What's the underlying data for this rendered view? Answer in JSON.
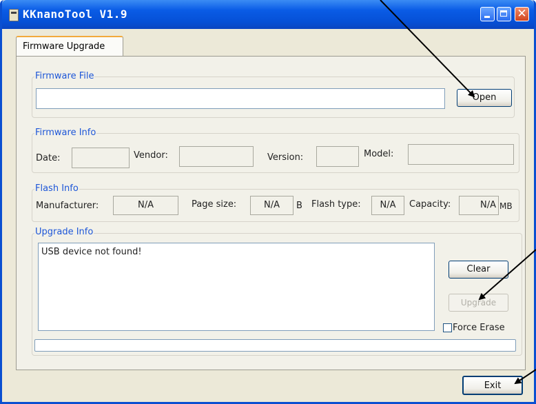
{
  "window": {
    "title": "KKnanoTool V1.9"
  },
  "titlebar_buttons": {
    "close_glyph": "✕"
  },
  "tab": {
    "label": "Firmware Upgrade"
  },
  "firmware_file": {
    "group_label": "Firmware File",
    "path_value": "",
    "open_button": "Open"
  },
  "firmware_info": {
    "group_label": "Firmware Info",
    "date_label": "Date:",
    "date_value": "",
    "vendor_label": "Vendor:",
    "vendor_value": "",
    "version_label": "Version:",
    "version_value": "",
    "model_label": "Model:",
    "model_value": ""
  },
  "flash_info": {
    "group_label": "Flash Info",
    "manufacturer_label": "Manufacturer:",
    "manufacturer_value": "N/A",
    "page_size_label": "Page size:",
    "page_size_value": "N/A",
    "page_size_unit": "B",
    "flash_type_label": "Flash type:",
    "flash_type_value": "N/A",
    "capacity_label": "Capacity:",
    "capacity_value": "N/A",
    "capacity_unit": "MB"
  },
  "upgrade_info": {
    "group_label": "Upgrade Info",
    "log_text": "USB device not found!",
    "clear_button": "Clear",
    "upgrade_button": "Upgrade",
    "force_erase_label": "Force Erase",
    "progress": 0
  },
  "footer": {
    "exit_button": "Exit"
  },
  "colors": {
    "titlebar": "#0a5ce6",
    "group_label": "#1d56d8",
    "window_bg": "#ece9d8",
    "arrow": "#000000"
  }
}
